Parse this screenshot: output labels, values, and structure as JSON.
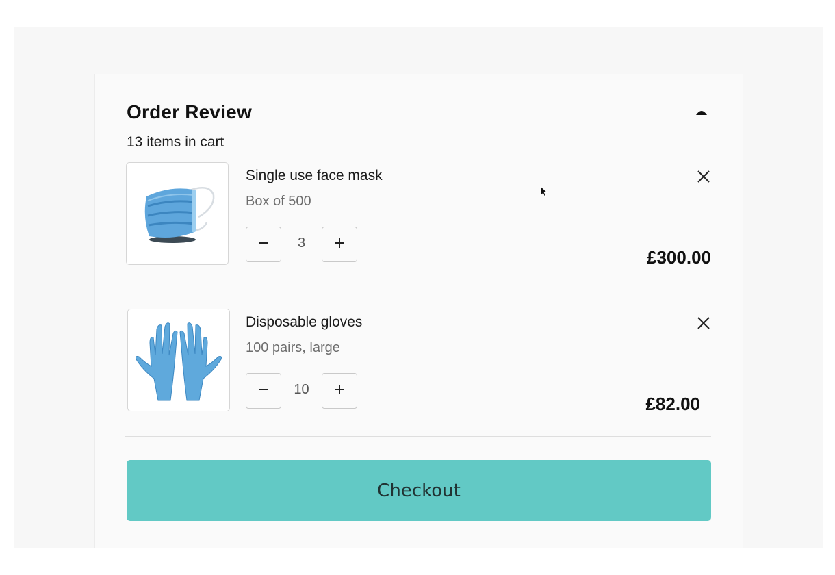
{
  "order_review": {
    "title": "Order Review",
    "item_count_text": "13 items in cart",
    "items": [
      {
        "name": "Single use face mask",
        "variant": "Box of 500",
        "quantity": "3",
        "price": "£300.00",
        "image_icon": "face-mask-image"
      },
      {
        "name": "Disposable gloves",
        "variant": "100 pairs, large",
        "quantity": "10",
        "price": "£82.00",
        "image_icon": "gloves-image"
      }
    ],
    "checkout_label": "Checkout"
  },
  "colors": {
    "accent": "#62c9c5",
    "text": "#111111",
    "muted": "#6d6d6d",
    "border": "#d6d6d6"
  },
  "icons": {
    "collapse": "caret-up-icon",
    "remove": "close-icon",
    "decrement": "minus-icon",
    "increment": "plus-icon"
  }
}
